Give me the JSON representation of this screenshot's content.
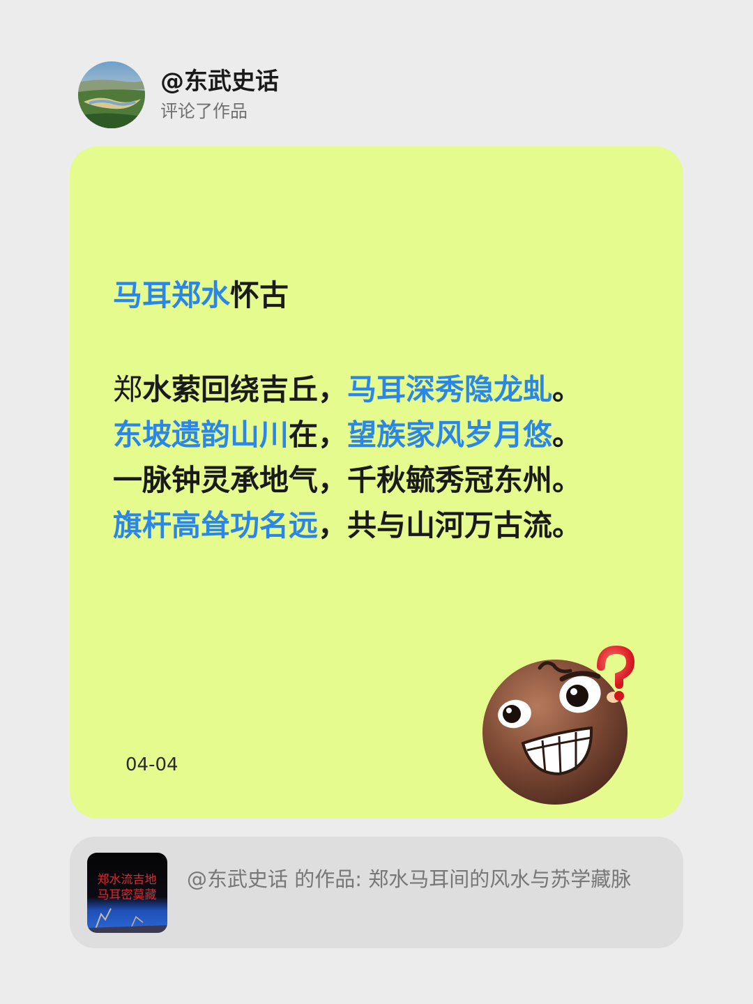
{
  "header": {
    "username": "@东武史话",
    "action": "评论了作品"
  },
  "card": {
    "title": [
      {
        "text": "马耳",
        "highlight": true
      },
      {
        "text": "郑水",
        "highlight": true
      },
      {
        "text": "怀古",
        "highlight": false
      }
    ],
    "lines": [
      [
        {
          "text": "郑",
          "highlight": false
        },
        {
          "text": "水萦回绕吉丘，",
          "highlight": false
        },
        {
          "text": "马耳深秀隐龙虬",
          "highlight": true
        },
        {
          "text": "。",
          "highlight": false
        }
      ],
      [
        {
          "text": "东坡遗韵山川",
          "highlight": true
        },
        {
          "text": "在，",
          "highlight": false
        },
        {
          "text": "望族家风岁月悠",
          "highlight": true
        },
        {
          "text": "。",
          "highlight": false
        }
      ],
      [
        {
          "text": "一脉钟灵承地气，千秋毓秀冠东州。",
          "highlight": false
        }
      ],
      [
        {
          "text": "旗杆高耸功名远",
          "highlight": true
        },
        {
          "text": "，共与山河万古流。",
          "highlight": false
        }
      ]
    ],
    "date": "04-04",
    "sticker": "grinning-question-emoji"
  },
  "reference": {
    "thumbnail_text": [
      "郑水流吉地",
      "马耳密莫藏"
    ],
    "text": "@东武史话 的作品: 郑水马耳间的风水与苏学藏脉"
  },
  "colors": {
    "background": "#ececec",
    "card": "#e6fb8e",
    "highlight": "#2a86e8",
    "reference_box": "#dedede"
  }
}
